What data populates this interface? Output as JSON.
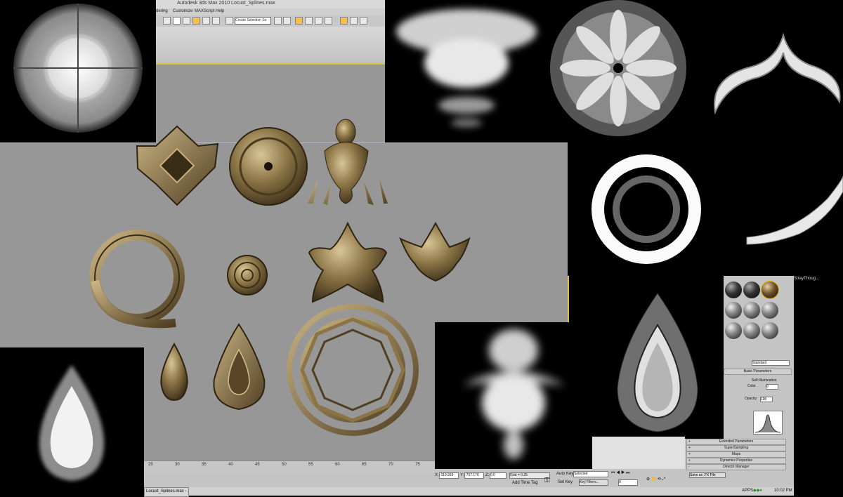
{
  "app": {
    "title": "Autodesk 3ds Max  2010     Locust_Splines.max",
    "menus": [
      "dering",
      "Customize",
      "MAXScript",
      "Help"
    ],
    "selection_set_placeholder": "Create Selection Se"
  },
  "ruler": {
    "ticks": [
      "25",
      "30",
      "35",
      "40",
      "45",
      "50",
      "55",
      "60",
      "65",
      "70",
      "75"
    ]
  },
  "status": {
    "x_label": "X:",
    "x_value": "-119.939",
    "y_label": "Y:",
    "y_value": "-767.176",
    "z_label": "Z:",
    "z_value": "0.0",
    "grid": "Grid = 0.25",
    "add_time_tag": "Add Time Tag"
  },
  "controls": {
    "auto_key": "Auto Key",
    "selected": "Selected",
    "set_key": "Set Key",
    "key_filters": "Key Filters...",
    "frame": "0"
  },
  "material_editor": {
    "window_title": "StrayThoug...",
    "type": "Standard",
    "rollouts": {
      "basic_parameters": "Basic Parameters",
      "self_illumination": "Self-Illumination",
      "color_label": "Color",
      "color_value": "0",
      "opacity_label": "Opacity:",
      "opacity_value": "100",
      "extended_parameters": "Extended Parameters",
      "supersampling": "SuperSampling",
      "maps": "Maps",
      "dynamics": "Dynamics Properties",
      "direct_manager": "DirectX Manager",
      "save_fx": "Save as .FX File"
    }
  },
  "taskbar": {
    "task": "Locust_Splines.max - ...",
    "apps": "APPS",
    "clock": "10:02 PM"
  },
  "colors": {
    "viewport": "#979797",
    "accent_yellow": "#d8c23a",
    "brass": "#8b7445"
  }
}
